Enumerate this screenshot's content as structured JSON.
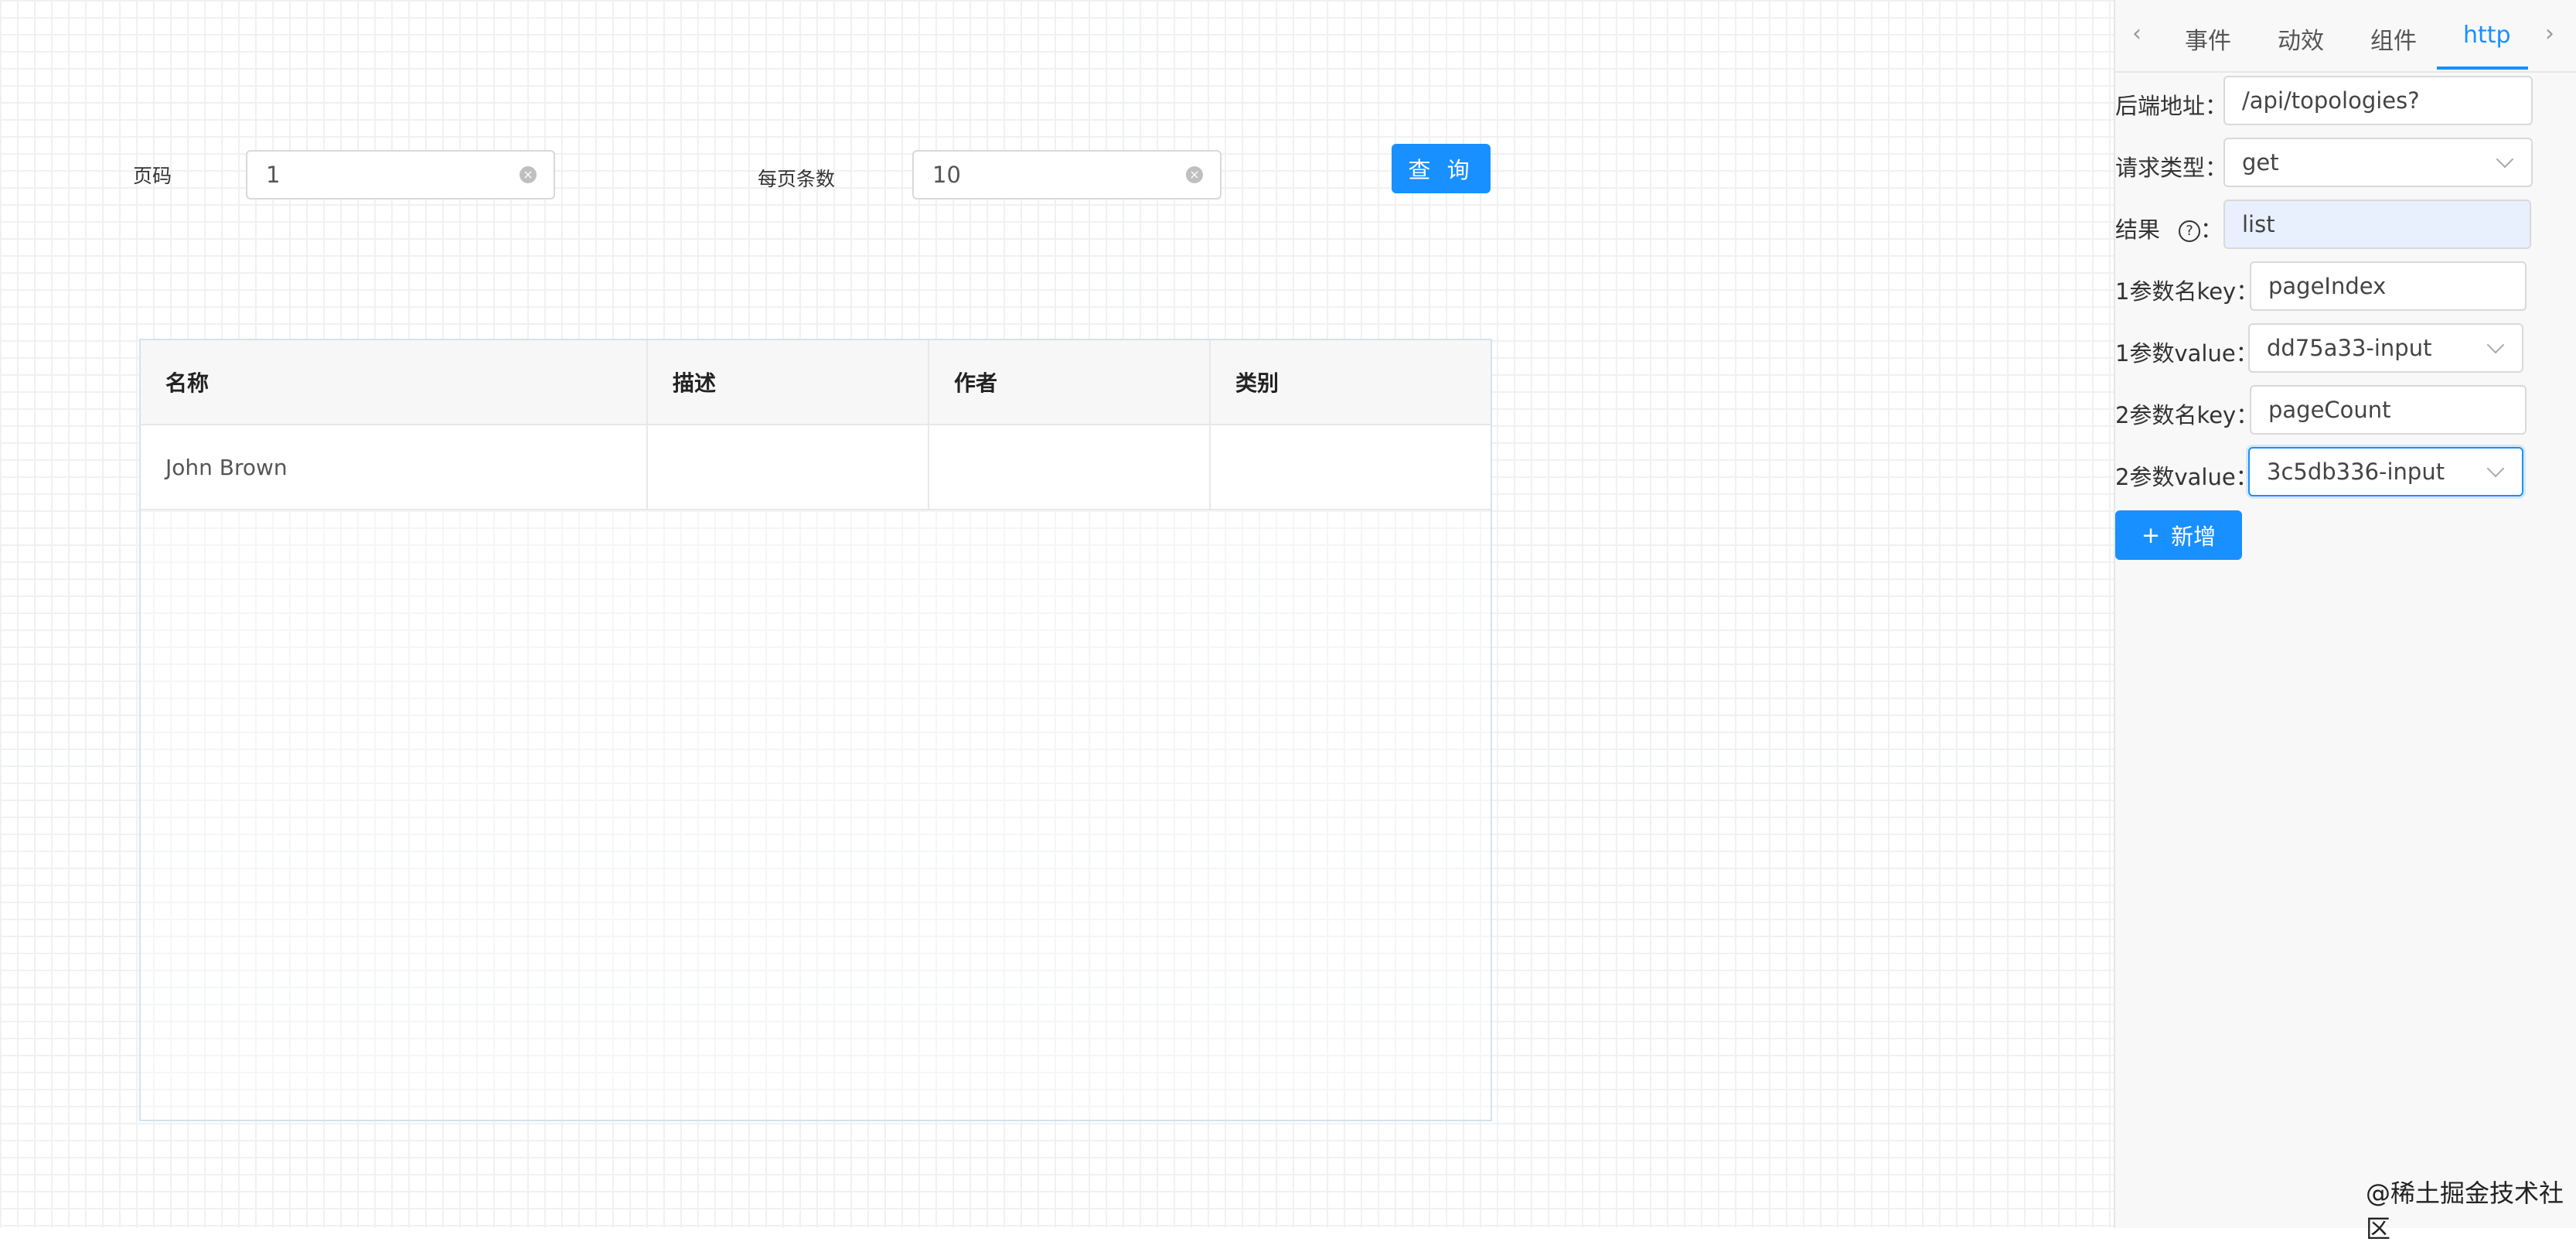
{
  "query_form": {
    "page_label": "页码",
    "page_value": "1",
    "size_label": "每页条数",
    "size_value": "10",
    "query_button": "查 询"
  },
  "table": {
    "columns": [
      "名称",
      "描述",
      "作者",
      "类别"
    ],
    "rows": [
      [
        "John Brown",
        "",
        "",
        ""
      ]
    ]
  },
  "panel": {
    "tabs": [
      "事件",
      "动效",
      "组件",
      "http"
    ],
    "active_tab": "http",
    "fields": {
      "backend_label": "后端地址：",
      "backend_value": "/api/topologies?",
      "method_label": "请求类型：",
      "method_value": "get",
      "result_label": "结果",
      "result_colon": "：",
      "result_value": "list",
      "p1_key_label": "1参数名key：",
      "p1_key_value": "pageIndex",
      "p1_value_label": "1参数value：",
      "p1_value_value": "dd75a33-input",
      "p2_key_label": "2参数名key：",
      "p2_key_value": "pageCount",
      "p2_value_label": "2参数value：",
      "p2_value_value": "3c5db336-input"
    },
    "add_button": "新增"
  },
  "watermark": "@稀土掘金技术社区",
  "colors": {
    "primary": "#1890ff",
    "grid": "#f0f1f3"
  },
  "icons": [
    "clear-icon",
    "chevron-left-icon",
    "chevron-right-icon",
    "chevron-down-icon",
    "help-icon",
    "plus-icon"
  ]
}
